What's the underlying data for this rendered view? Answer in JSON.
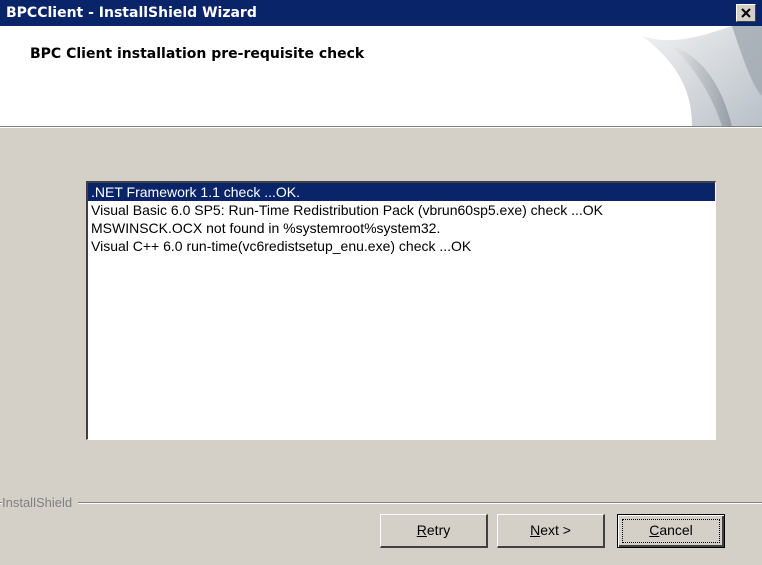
{
  "window": {
    "title": "BPCClient - InstallShield Wizard"
  },
  "header": {
    "title": "BPC Client installation pre-requisite check"
  },
  "checklist": {
    "items": [
      ".NET Framework 1.1 check ...OK.",
      "Visual Basic 6.0 SP5: Run-Time Redistribution Pack (vbrun60sp5.exe) check ...OK",
      "MSWINSCK.OCX not found in  %systemroot%system32.",
      "Visual C++ 6.0 run-time(vc6redistsetup_enu.exe) check ...OK"
    ],
    "selected_index": 0
  },
  "footer": {
    "brand_label": "InstallShield"
  },
  "buttons": {
    "retry": {
      "mnemonic": "R",
      "rest": "etry"
    },
    "next": {
      "mnemonic": "N",
      "rest": "ext >"
    },
    "cancel": {
      "mnemonic": "C",
      "rest": "ancel"
    }
  },
  "colors": {
    "titlebar": "#0a246a",
    "selection": "#0a246a",
    "dialog_face": "#d4d0c8"
  },
  "icons": {
    "close": "close-icon",
    "header": "page-curl-graphic"
  }
}
